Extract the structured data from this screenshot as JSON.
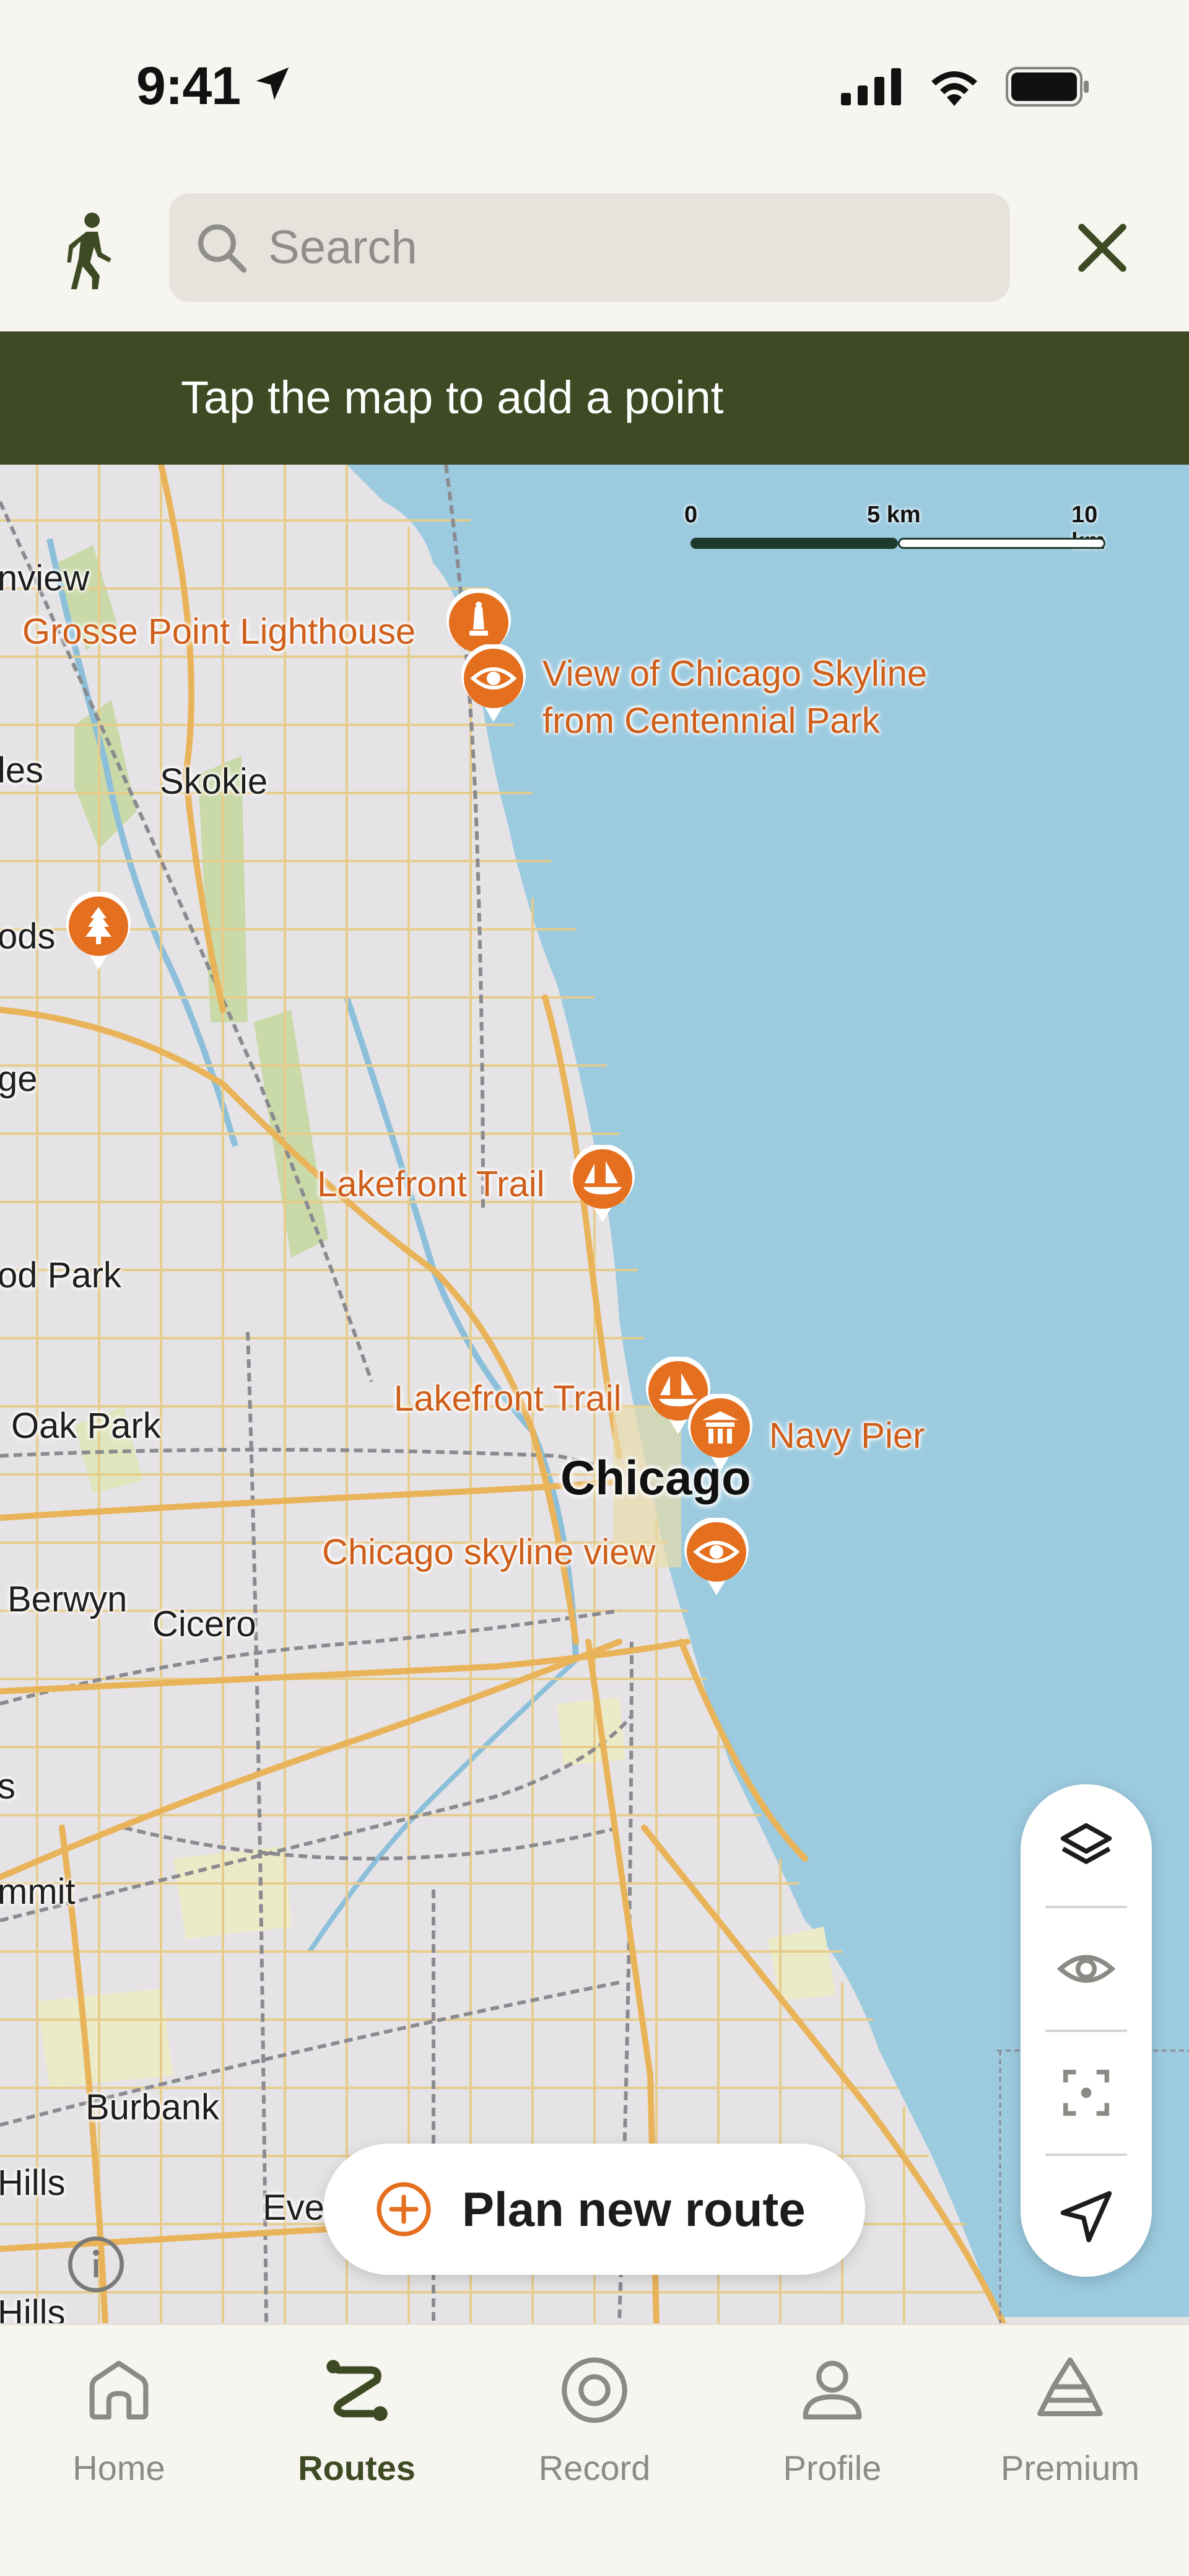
{
  "status_bar": {
    "time": "9:41",
    "icons": [
      "location-arrow-icon",
      "cellular-signal-icon",
      "wifi-icon",
      "battery-icon"
    ]
  },
  "header": {
    "activity_icon": "hiker-icon",
    "search": {
      "placeholder": "Search",
      "value": ""
    },
    "close_icon": "close-icon"
  },
  "banner": {
    "text": "Tap the map to add a point"
  },
  "map": {
    "scale": {
      "labels": [
        "0",
        "5 km",
        "10 km"
      ]
    },
    "place_labels": [
      "nview",
      "les",
      "Skokie",
      "ods",
      "ge",
      "od Park",
      "Oak Park",
      "Berwyn",
      "Cicero",
      "s",
      "mmit",
      "Burbank",
      "Hills",
      "Eve",
      "Hills"
    ],
    "city_label": "Chicago",
    "poi": [
      {
        "label": "Grosse Point Lighthouse",
        "icon": "lighthouse-icon"
      },
      {
        "label": "View of Chicago Skyline\nfrom Centennial Park",
        "icon": "viewpoint-icon"
      },
      {
        "label": "",
        "icon": "tree-icon"
      },
      {
        "label": "Lakefront Trail",
        "icon": "sailboat-icon"
      },
      {
        "label": "Lakefront Trail",
        "icon": "sailboat-icon"
      },
      {
        "label": "Navy Pier",
        "icon": "pier-icon"
      },
      {
        "label": "Chicago skyline view",
        "icon": "viewpoint-icon"
      }
    ],
    "controls": [
      "layers-icon",
      "eye-icon",
      "focus-icon",
      "navigation-arrow-icon"
    ],
    "info_icon": "info-icon"
  },
  "plan_button": {
    "label": "Plan new route",
    "icon": "plus-circle-icon"
  },
  "tabs": [
    {
      "label": "Home",
      "icon": "home-icon",
      "active": false
    },
    {
      "label": "Routes",
      "icon": "routes-icon",
      "active": true
    },
    {
      "label": "Record",
      "icon": "record-icon",
      "active": false
    },
    {
      "label": "Profile",
      "icon": "profile-icon",
      "active": false
    },
    {
      "label": "Premium",
      "icon": "premium-icon",
      "active": false
    }
  ],
  "colors": {
    "brand_olive": "#3d4a23",
    "poi_orange": "#e46f1f",
    "water": "#9ccbe0",
    "land": "#e6e3e6",
    "road_major": "#e9b359",
    "road_minor": "#e6cc8a"
  }
}
